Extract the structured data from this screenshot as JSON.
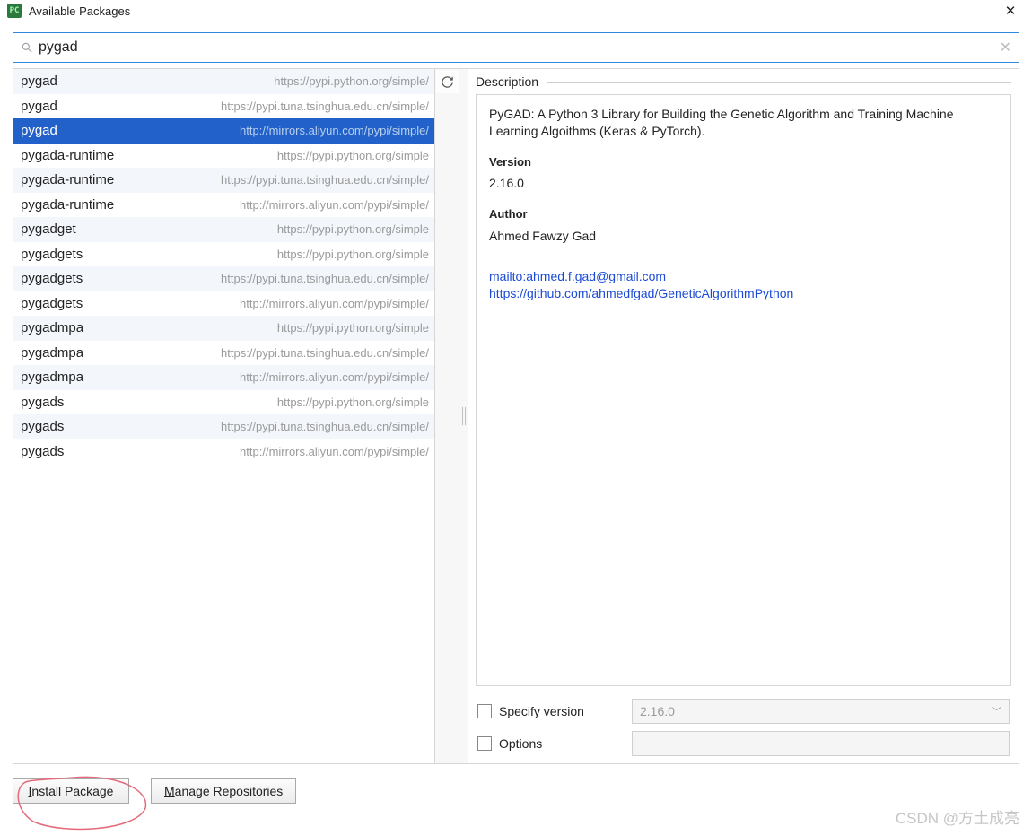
{
  "window": {
    "title": "Available Packages"
  },
  "search": {
    "value": "pygad"
  },
  "packages": [
    {
      "name": "pygad",
      "src": "https://pypi.python.org/simple/",
      "alt": true
    },
    {
      "name": "pygad",
      "src": "https://pypi.tuna.tsinghua.edu.cn/simple/",
      "alt": false
    },
    {
      "name": "pygad",
      "src": "http://mirrors.aliyun.com/pypi/simple/",
      "selected": true
    },
    {
      "name": "pygada-runtime",
      "src": "https://pypi.python.org/simple",
      "alt": false
    },
    {
      "name": "pygada-runtime",
      "src": "https://pypi.tuna.tsinghua.edu.cn/simple/",
      "alt": true
    },
    {
      "name": "pygada-runtime",
      "src": "http://mirrors.aliyun.com/pypi/simple/",
      "alt": false
    },
    {
      "name": "pygadget",
      "src": "https://pypi.python.org/simple",
      "alt": true
    },
    {
      "name": "pygadgets",
      "src": "https://pypi.python.org/simple",
      "alt": false
    },
    {
      "name": "pygadgets",
      "src": "https://pypi.tuna.tsinghua.edu.cn/simple/",
      "alt": true
    },
    {
      "name": "pygadgets",
      "src": "http://mirrors.aliyun.com/pypi/simple/",
      "alt": false
    },
    {
      "name": "pygadmpa",
      "src": "https://pypi.python.org/simple",
      "alt": true
    },
    {
      "name": "pygadmpa",
      "src": "https://pypi.tuna.tsinghua.edu.cn/simple/",
      "alt": false
    },
    {
      "name": "pygadmpa",
      "src": "http://mirrors.aliyun.com/pypi/simple/",
      "alt": true
    },
    {
      "name": "pygads",
      "src": "https://pypi.python.org/simple",
      "alt": false
    },
    {
      "name": "pygads",
      "src": "https://pypi.tuna.tsinghua.edu.cn/simple/",
      "alt": true
    },
    {
      "name": "pygads",
      "src": "http://mirrors.aliyun.com/pypi/simple/",
      "alt": false
    }
  ],
  "description": {
    "header": "Description",
    "summary": "PyGAD: A Python 3 Library for Building the Genetic Algorithm and Training Machine Learning Algoithms (Keras & PyTorch).",
    "version_label": "Version",
    "version": "2.16.0",
    "author_label": "Author",
    "author": "Ahmed Fawzy Gad",
    "links": [
      "mailto:ahmed.f.gad@gmail.com",
      "https://github.com/ahmedfgad/GeneticAlgorithmPython"
    ]
  },
  "options": {
    "specify_version_label": "Specify version",
    "specify_version_value": "2.16.0",
    "options_label": "Options"
  },
  "buttons": {
    "install": "Install Package",
    "manage": "Manage Repositories"
  },
  "watermark": "CSDN @方土成亮"
}
